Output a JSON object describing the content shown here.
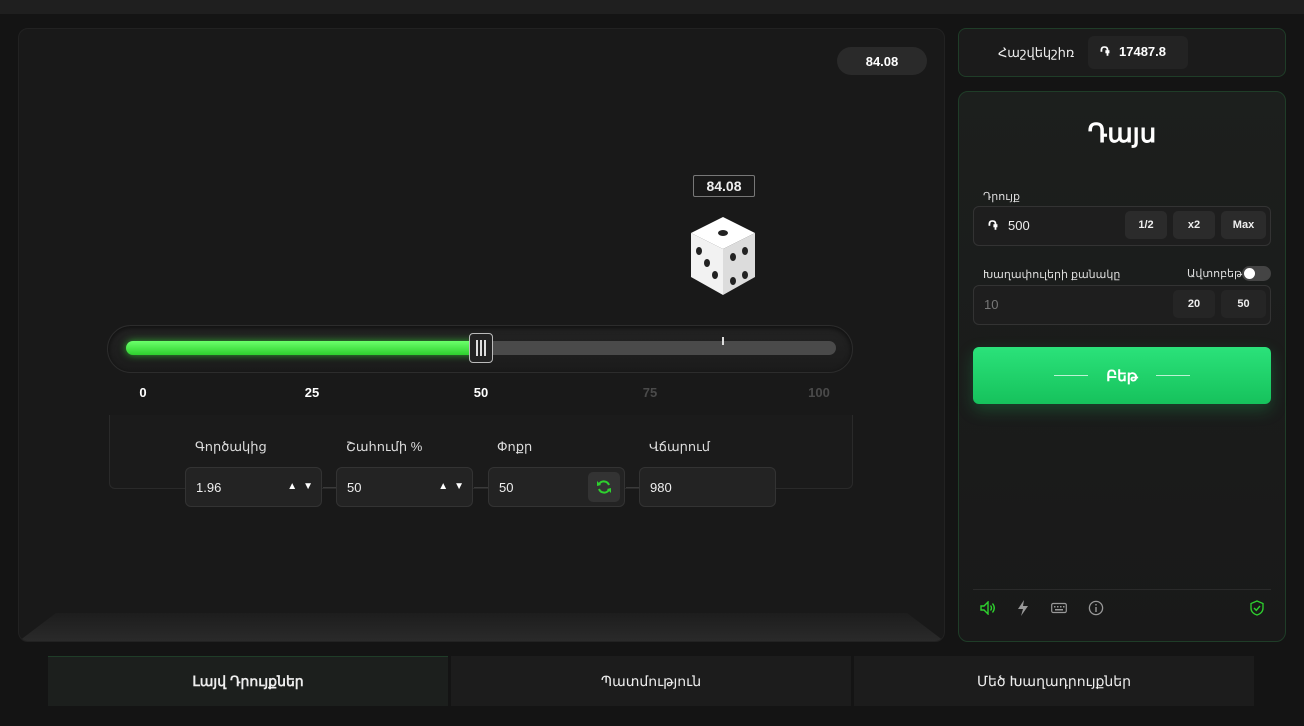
{
  "game": {
    "last_result": "84.08",
    "dice_result": "84.08",
    "slider": {
      "value": 50,
      "result": 84.08,
      "min": 0,
      "max": 100
    },
    "ticks": [
      "0",
      "25",
      "50",
      "75",
      "100"
    ],
    "stats": {
      "multiplier_label": "Գործակից",
      "multiplier_value": "1.96",
      "win_chance_label": "Շահումի %",
      "win_chance_value": "50",
      "roll_label": "Փոքր",
      "roll_value": "50",
      "payout_label": "Վճարում",
      "payout_value": "980"
    }
  },
  "balance": {
    "label": "Հաշվեկշիռ",
    "currency_symbol": "֏",
    "amount": "17487.8"
  },
  "panel": {
    "title": "Դայս",
    "bet_label": "Դրույք",
    "bet_currency": "֏",
    "bet_value": "500",
    "half_label": "1/2",
    "double_label": "x2",
    "max_label": "Max",
    "games_label": "Խաղափուլերի քանակը",
    "auto_label": "Ավտոբեթ",
    "games_placeholder": "10",
    "games_opt1": "20",
    "games_opt2": "50",
    "play_label": "Բեթ"
  },
  "colors": {
    "accent": "#2ed12e",
    "button": "#1fd16b"
  },
  "tabs": [
    "Լայվ Դրույքներ",
    "Պատմություն",
    "Մեծ Խաղադրույքներ"
  ]
}
